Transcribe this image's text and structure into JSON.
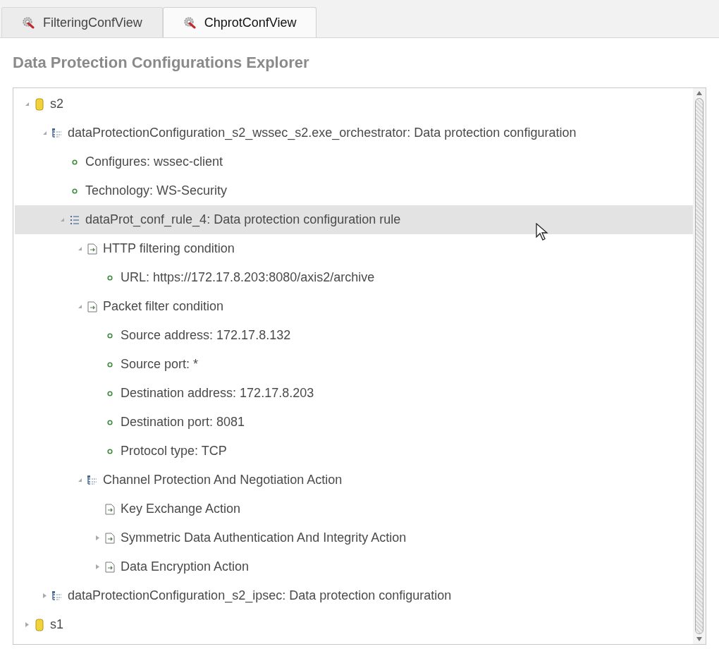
{
  "tabs": [
    {
      "label": "FilteringConfView",
      "selected": false
    },
    {
      "label": "ChprotConfView",
      "selected": true
    }
  ],
  "title": "Data Protection Configurations Explorer",
  "tree": [
    {
      "kind": "server",
      "label": "s2",
      "expanded": true,
      "selected": false,
      "children": [
        {
          "kind": "config",
          "label": "dataProtectionConfiguration_s2_wssec_s2.exe_orchestrator: Data protection configuration",
          "expanded": true,
          "selected": false,
          "children": [
            {
              "kind": "property",
              "label": "Configures: wssec-client",
              "selected": false
            },
            {
              "kind": "property",
              "label": "Technology: WS-Security",
              "selected": false
            },
            {
              "kind": "rule",
              "label": "dataProt_conf_rule_4: Data protection configuration rule",
              "expanded": true,
              "selected": true,
              "children": [
                {
                  "kind": "condition",
                  "label": "HTTP filtering condition",
                  "expanded": true,
                  "selected": false,
                  "children": [
                    {
                      "kind": "property",
                      "label": "URL: https://172.17.8.203:8080/axis2/archive",
                      "selected": false
                    }
                  ]
                },
                {
                  "kind": "condition",
                  "label": "Packet filter condition",
                  "expanded": true,
                  "selected": false,
                  "children": [
                    {
                      "kind": "property",
                      "label": "Source address: 172.17.8.132",
                      "selected": false
                    },
                    {
                      "kind": "property",
                      "label": "Source port: *",
                      "selected": false
                    },
                    {
                      "kind": "property",
                      "label": "Destination address: 172.17.8.203",
                      "selected": false
                    },
                    {
                      "kind": "property",
                      "label": "Destination port: 8081",
                      "selected": false
                    },
                    {
                      "kind": "property",
                      "label": "Protocol type: TCP",
                      "selected": false
                    }
                  ]
                },
                {
                  "kind": "config",
                  "label": "Channel Protection And Negotiation Action",
                  "expanded": true,
                  "selected": false,
                  "children": [
                    {
                      "kind": "condition",
                      "label": "Key Exchange Action",
                      "selected": false
                    },
                    {
                      "kind": "condition",
                      "label": "Symmetric Data Authentication And Integrity Action",
                      "expanded": false,
                      "selected": false
                    },
                    {
                      "kind": "condition",
                      "label": "Data Encryption Action",
                      "expanded": false,
                      "selected": false
                    }
                  ]
                }
              ]
            }
          ]
        },
        {
          "kind": "config",
          "label": "dataProtectionConfiguration_s2_ipsec: Data protection configuration",
          "expanded": false,
          "selected": false
        }
      ]
    },
    {
      "kind": "server",
      "label": "s1",
      "expanded": false,
      "selected": false
    }
  ]
}
